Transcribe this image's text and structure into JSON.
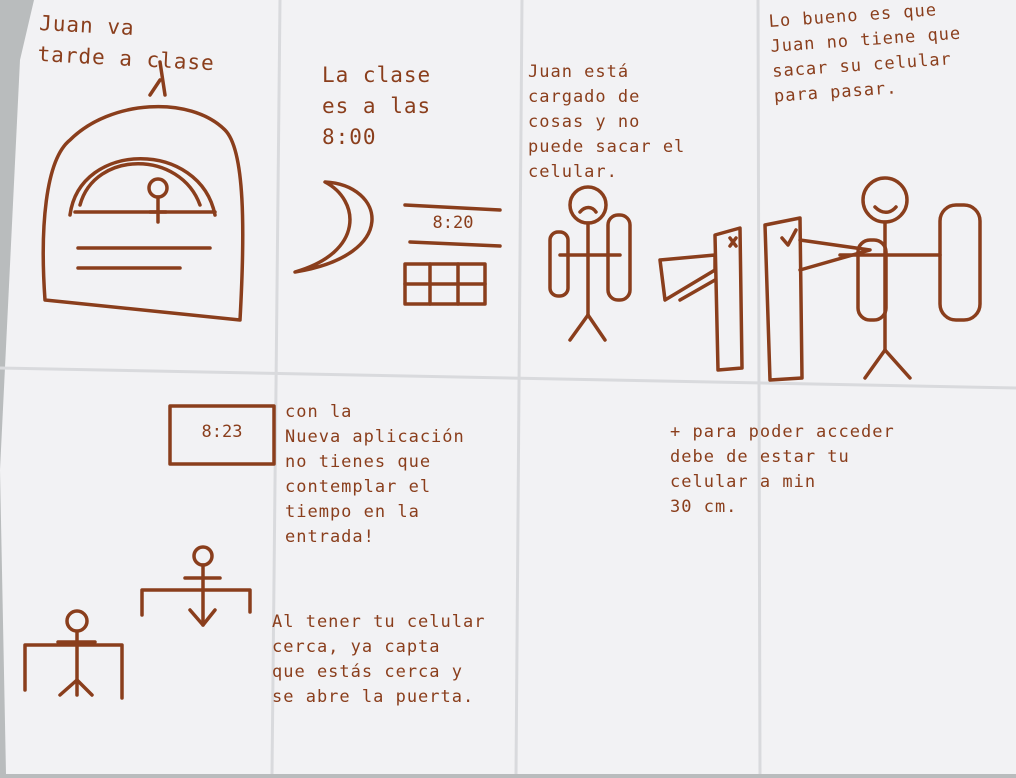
{
  "colors": {
    "ink": "#8a3e1c",
    "paper": "#f2f2f4",
    "background": "#b9bcbd",
    "fold": "#d9dadd"
  },
  "panels": {
    "p1": {
      "text": "Juan      va\ntarde  a   clase"
    },
    "p2": {
      "text": "La clase\nes a las\n8:00",
      "clock": "8:20"
    },
    "p3": {
      "text": "Juan está\ncargado de\ncosas y no\npuede sacar el\n            celular."
    },
    "p4": {
      "text": "Lo bueno es que\nJuan no tiene que\nsacar su celular\npara pasar."
    },
    "p5": {
      "clock": "8:23"
    },
    "p6": {
      "text": "con la\nNueva aplicación\nno tienes que\ncontemplar el\ntiempo en la\nentrada!",
      "text2": "Al tener tu celular\ncerca, ya capta\nque estás cerca y\nse abre la puerta."
    },
    "p7": {
      "text": "+ para poder acceder\n   debe de estar tu\n   celular a min\n   30 cm."
    }
  },
  "icons": {
    "building": "building-icon",
    "moon": "moon-icon",
    "person_sad": "person-sad-icon",
    "person_happy": "person-happy-icon",
    "turnstile": "turnstile-icon",
    "person_at_desk": "person-at-desk-icon"
  }
}
